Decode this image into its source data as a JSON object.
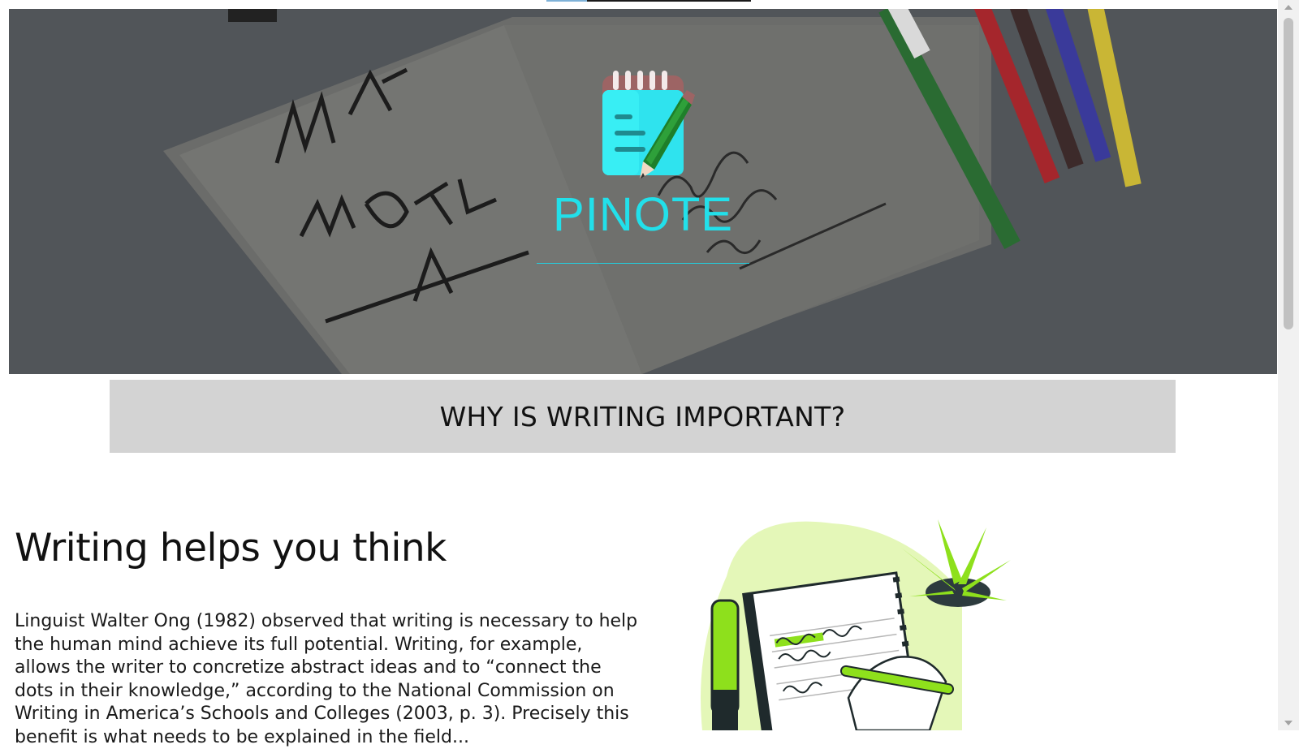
{
  "page": {
    "scroll_progress": 0.2
  },
  "hero": {
    "brand": "PINOTE",
    "logo_icon": "notepad-pencil-icon",
    "background_description_colors": {
      "overlay": "#4f5358",
      "brand": "#22e0ea"
    }
  },
  "section": {
    "heading": "WHY IS WRITING IMPORTANT?"
  },
  "content": {
    "title": "Writing helps you think",
    "body": "Linguist Walter Ong (1982) observed that writing is necessary to help the human mind achieve its full potential. Writing, for example, allows the writer to concretize abstract ideas and to “connect the dots in their knowledge,” according to the National Commission on Writing in America’s Schools and Colleges (2003, p. 3). Precisely this benefit is what needs to be explained in the field..."
  },
  "illustration": {
    "icon": "person-writing-notebook-icon"
  }
}
